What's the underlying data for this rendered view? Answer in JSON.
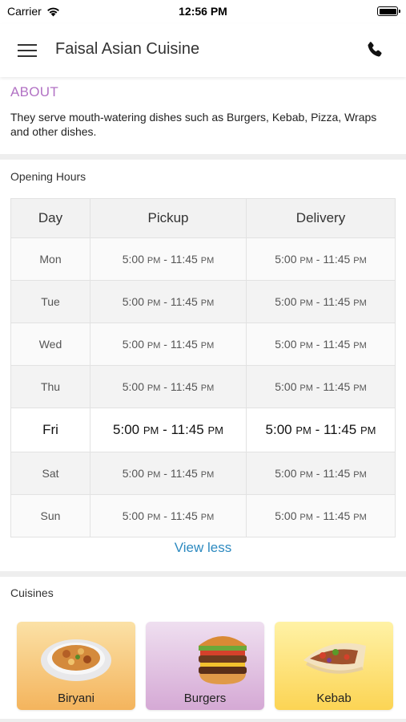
{
  "status_bar": {
    "carrier": "Carrier",
    "time": "12:56 PM"
  },
  "header": {
    "title": "Faisal Asian Cuisine"
  },
  "about": {
    "title": "ABOUT",
    "text": "They serve mouth-watering dishes such as Burgers, Kebab, Pizza, Wraps and other dishes."
  },
  "hours": {
    "title": "Opening Hours",
    "columns": [
      "Day",
      "Pickup",
      "Delivery"
    ],
    "rows": [
      {
        "day": "Mon",
        "pickup": {
          "open": "5:00",
          "open_ampm": "PM",
          "close": "11:45",
          "close_ampm": "PM"
        },
        "delivery": {
          "open": "5:00",
          "open_ampm": "PM",
          "close": "11:45",
          "close_ampm": "PM"
        }
      },
      {
        "day": "Tue",
        "pickup": {
          "open": "5:00",
          "open_ampm": "PM",
          "close": "11:45",
          "close_ampm": "PM"
        },
        "delivery": {
          "open": "5:00",
          "open_ampm": "PM",
          "close": "11:45",
          "close_ampm": "PM"
        }
      },
      {
        "day": "Wed",
        "pickup": {
          "open": "5:00",
          "open_ampm": "PM",
          "close": "11:45",
          "close_ampm": "PM"
        },
        "delivery": {
          "open": "5:00",
          "open_ampm": "PM",
          "close": "11:45",
          "close_ampm": "PM"
        }
      },
      {
        "day": "Thu",
        "pickup": {
          "open": "5:00",
          "open_ampm": "PM",
          "close": "11:45",
          "close_ampm": "PM"
        },
        "delivery": {
          "open": "5:00",
          "open_ampm": "PM",
          "close": "11:45",
          "close_ampm": "PM"
        }
      },
      {
        "day": "Fri",
        "pickup": {
          "open": "5:00",
          "open_ampm": "PM",
          "close": "11:45",
          "close_ampm": "PM"
        },
        "delivery": {
          "open": "5:00",
          "open_ampm": "PM",
          "close": "11:45",
          "close_ampm": "PM"
        }
      },
      {
        "day": "Sat",
        "pickup": {
          "open": "5:00",
          "open_ampm": "PM",
          "close": "11:45",
          "close_ampm": "PM"
        },
        "delivery": {
          "open": "5:00",
          "open_ampm": "PM",
          "close": "11:45",
          "close_ampm": "PM"
        }
      },
      {
        "day": "Sun",
        "pickup": {
          "open": "5:00",
          "open_ampm": "PM",
          "close": "11:45",
          "close_ampm": "PM"
        },
        "delivery": {
          "open": "5:00",
          "open_ampm": "PM",
          "close": "11:45",
          "close_ampm": "PM"
        }
      }
    ],
    "view_less": "View less"
  },
  "cuisines": {
    "title": "Cuisines",
    "items": [
      {
        "label": "Biryani",
        "bg_top": "#fbe1a6",
        "bg_bottom": "#f4b45d"
      },
      {
        "label": "Burgers",
        "bg_top": "#efdff0",
        "bg_bottom": "#d5a9d5"
      },
      {
        "label": "Kebab",
        "bg_top": "#fff2a6",
        "bg_bottom": "#fcd454"
      }
    ]
  },
  "colors": {
    "accent_about": "#b272c4",
    "link": "#2d8ac0"
  },
  "icons": {
    "menu": "hamburger-menu-icon",
    "call": "phone-icon",
    "wifi": "wifi-icon",
    "battery": "battery-icon"
  }
}
